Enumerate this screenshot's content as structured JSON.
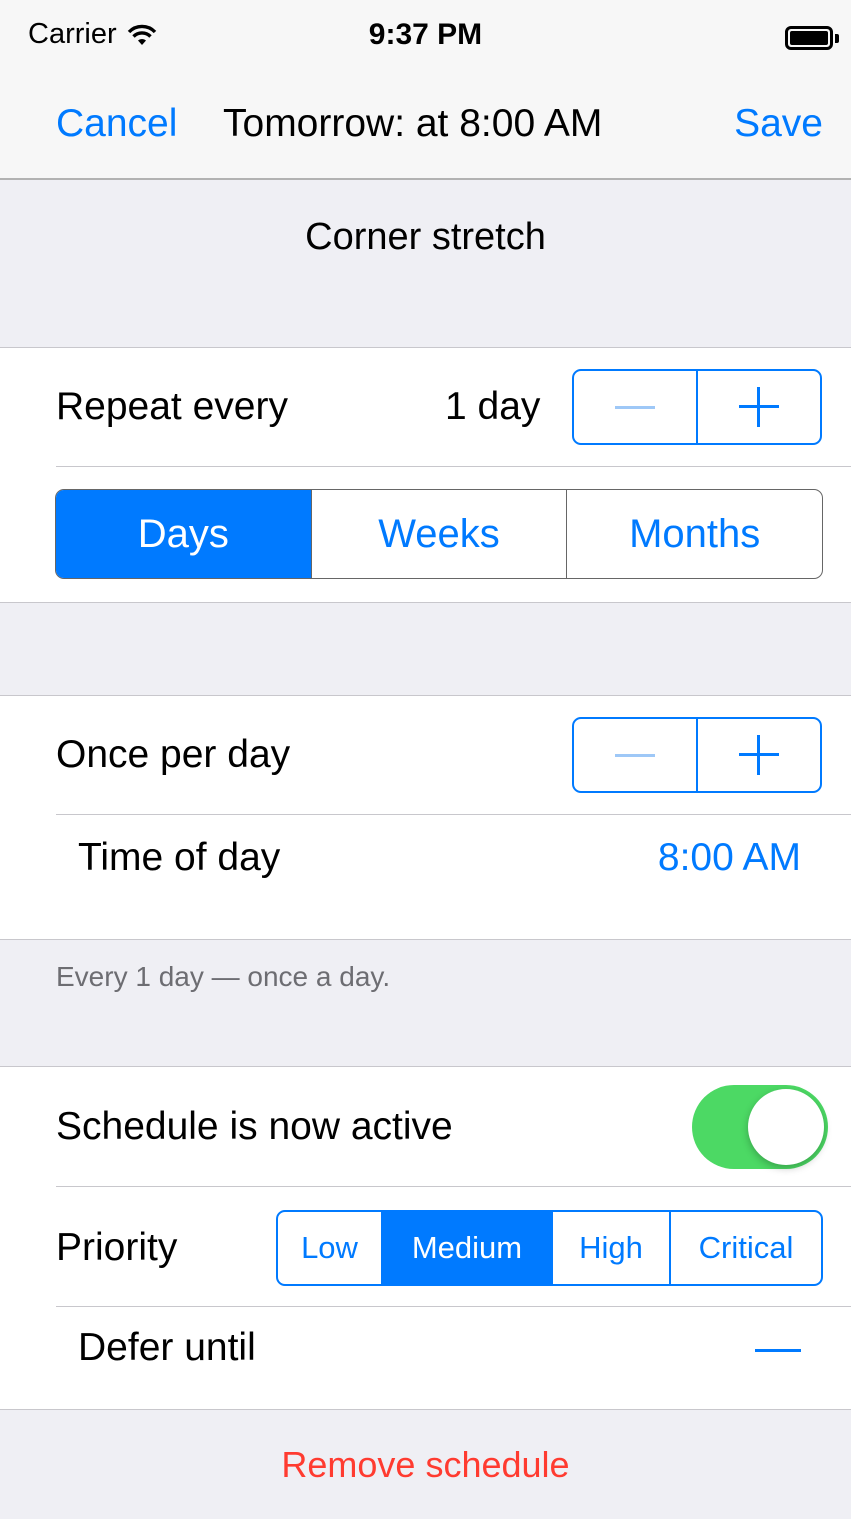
{
  "status_bar": {
    "carrier": "Carrier",
    "time": "9:37 PM"
  },
  "nav": {
    "cancel": "Cancel",
    "title": "Tomorrow: at 8:00 AM",
    "save": "Save"
  },
  "item_title": "Corner stretch",
  "repeat": {
    "label": "Repeat every",
    "value": "1 day",
    "units": [
      "Days",
      "Weeks",
      "Months"
    ],
    "selected_unit": "Days"
  },
  "frequency": {
    "label": "Once per day",
    "time_label": "Time of day",
    "time_value": "8:00 AM"
  },
  "summary": "Every 1 day  — once a day.",
  "schedule": {
    "active_label": "Schedule is now active",
    "active": true,
    "priority_label": "Priority",
    "priority_options": [
      "Low",
      "Medium",
      "High",
      "Critical"
    ],
    "priority_selected": "Medium",
    "defer_label": "Defer until"
  },
  "remove_label": "Remove schedule",
  "colors": {
    "accent": "#007aff",
    "toggle_on": "#4cd964",
    "destructive": "#ff3b30"
  }
}
